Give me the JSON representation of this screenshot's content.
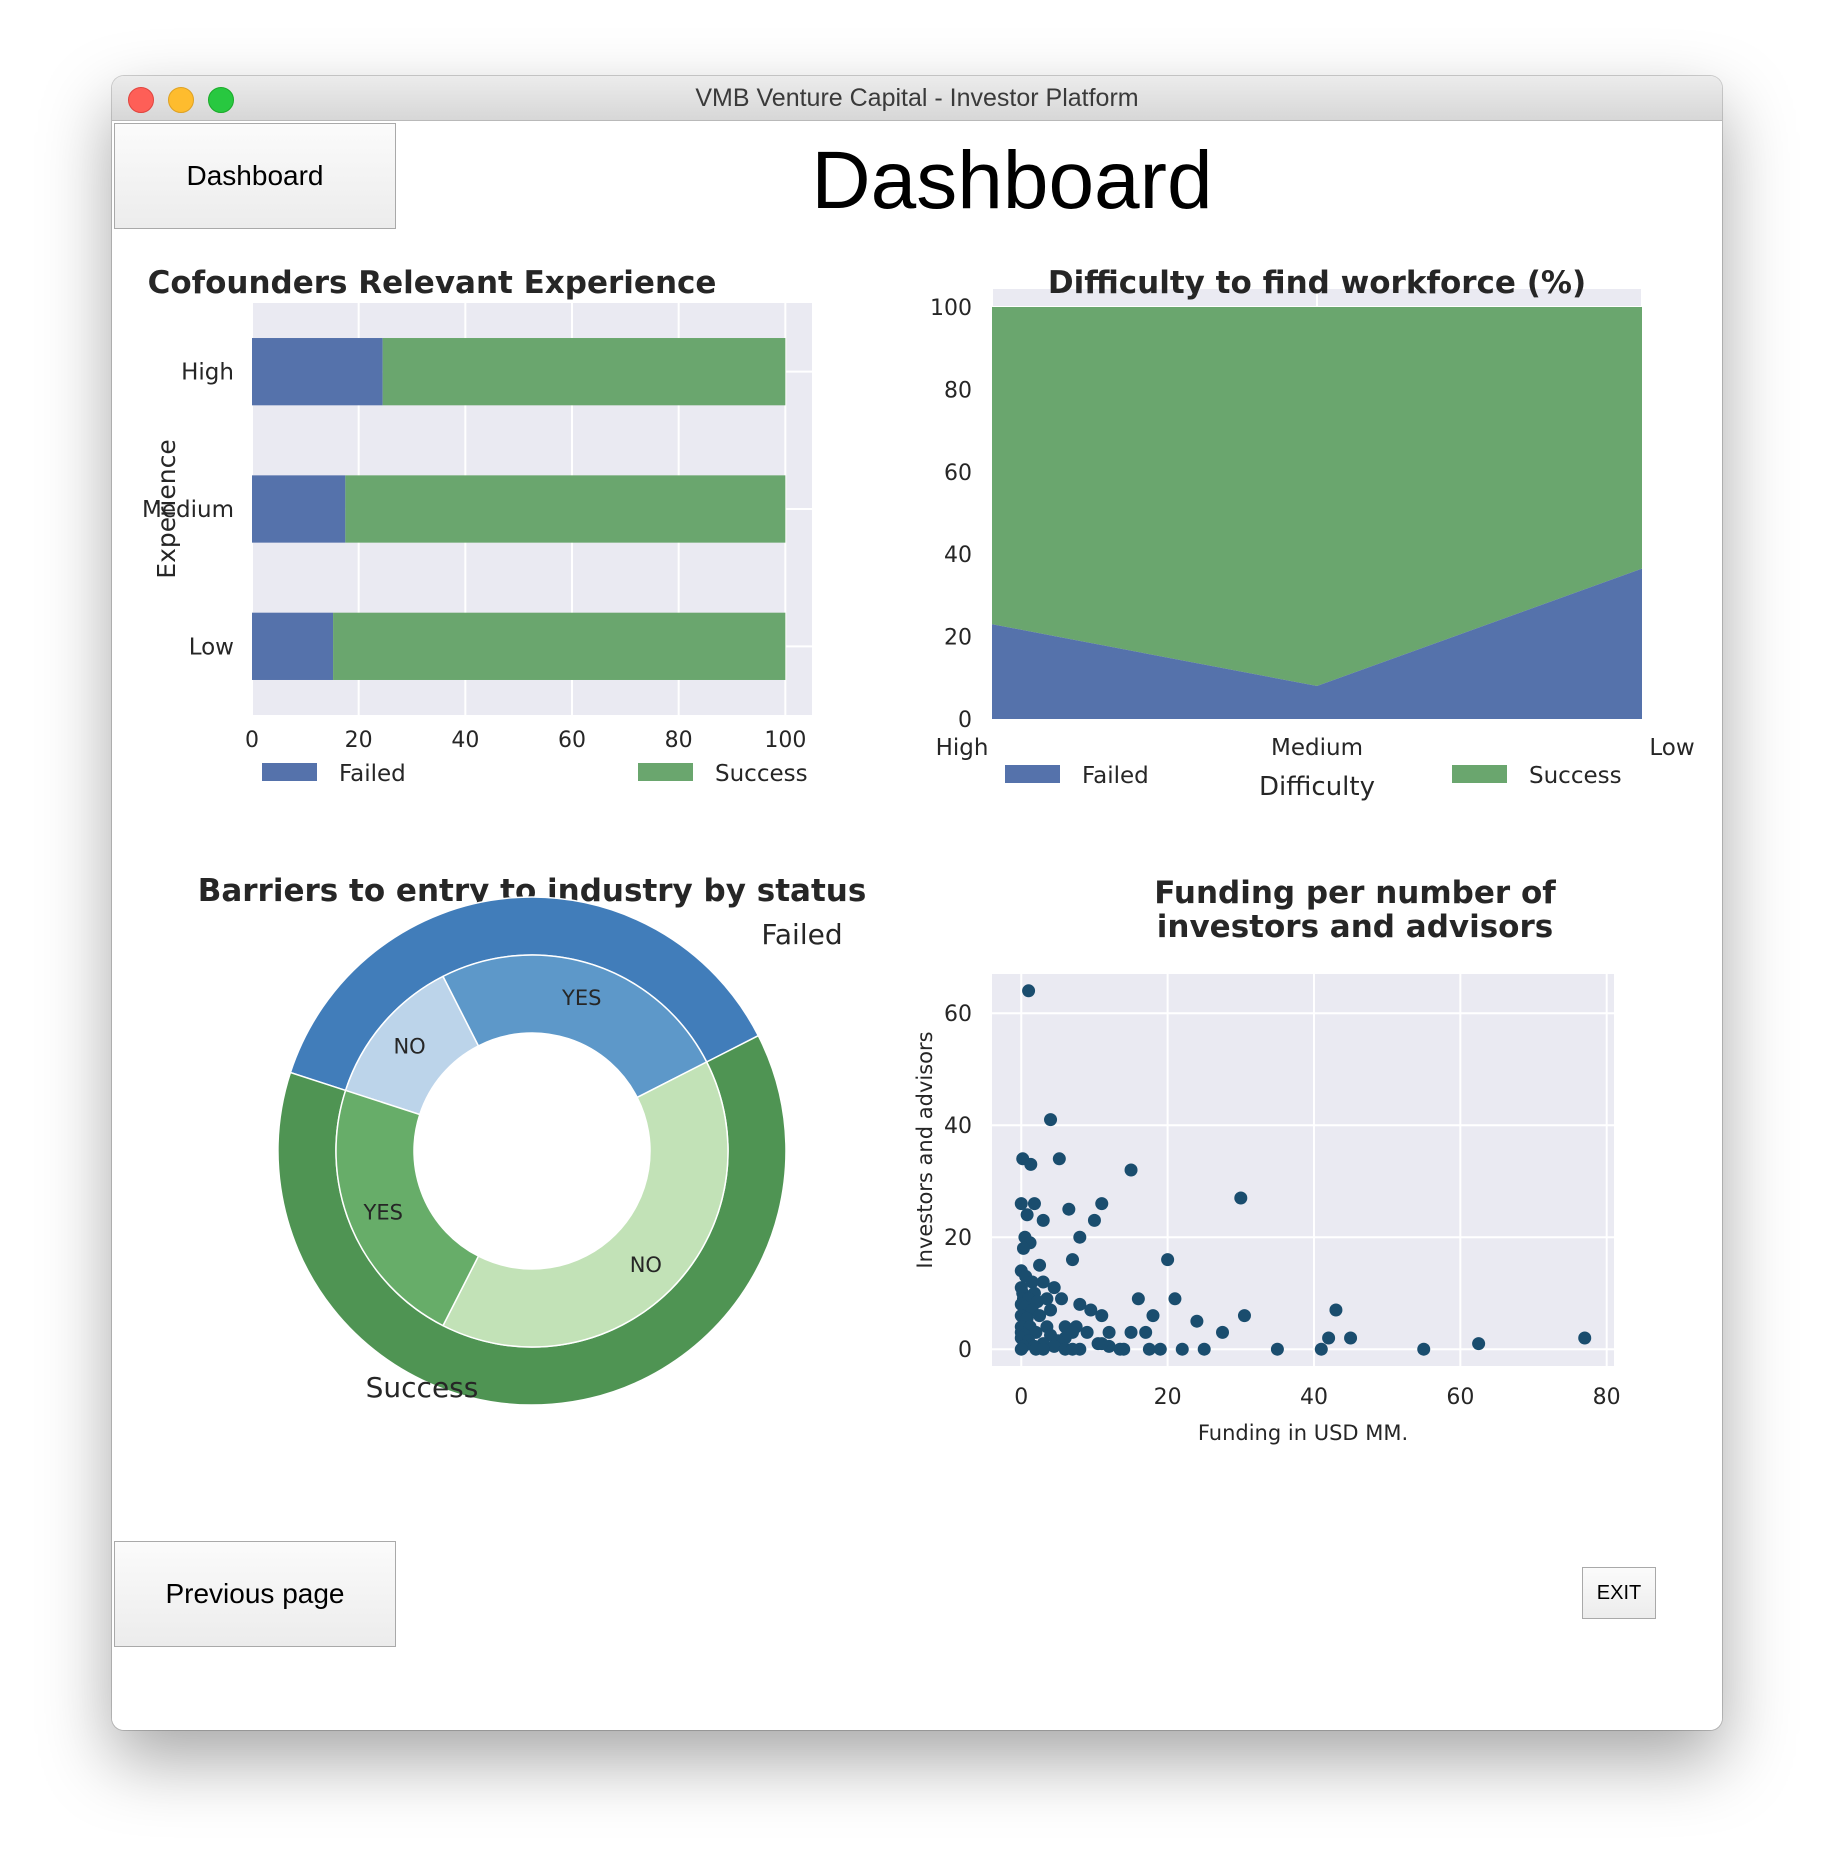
{
  "window": {
    "title": "VMB Venture Capital - Investor Platform"
  },
  "nav": {
    "dashboard_label": "Dashboard",
    "previous_label": "Previous page",
    "exit_label": "EXIT"
  },
  "page": {
    "title": "Dashboard"
  },
  "colors": {
    "failed": "#5572ab",
    "success": "#6aa66e",
    "plot_bg": "#eaeaf2",
    "scatter": "#1a4d6e"
  },
  "chart_data": [
    {
      "type": "bar",
      "orientation": "horizontal",
      "stacked": true,
      "title": "Cofounders Relevant Experience",
      "ylabel": "Experience",
      "xlabel": "",
      "categories": [
        "High",
        "Medium",
        "Low"
      ],
      "series": [
        {
          "name": "Failed",
          "values": [
            24.5,
            17.5,
            15.2
          ]
        },
        {
          "name": "Success",
          "values": [
            75.5,
            82.5,
            84.8
          ]
        }
      ],
      "xlim": [
        0,
        105
      ],
      "xticks": [
        0,
        20,
        40,
        60,
        80,
        100
      ],
      "legend": "bottom",
      "grid": true
    },
    {
      "type": "area",
      "stacked": true,
      "title": "Difficulty to find workforce (%)",
      "xlabel": "Difficulty",
      "ylabel": "",
      "categories": [
        "High",
        "Medium",
        "Low"
      ],
      "series": [
        {
          "name": "Failed",
          "values": [
            23,
            8,
            36.5
          ]
        },
        {
          "name": "Success",
          "values": [
            77,
            92,
            63.5
          ]
        }
      ],
      "ylim": [
        0,
        100
      ],
      "yticks": [
        0,
        20,
        40,
        60,
        80,
        100
      ],
      "legend": "bottom",
      "grid": true
    },
    {
      "type": "pie",
      "style": "nested-donut",
      "title": "Barriers to entry to industry by status",
      "outer": [
        {
          "label": "Failed",
          "value": 37.5,
          "color": "#417dba"
        },
        {
          "label": "Success",
          "value": 62.5,
          "color": "#4f9453"
        }
      ],
      "inner": [
        {
          "label": "NO",
          "value": 12.5,
          "color": "#bcd4ea"
        },
        {
          "label": "YES",
          "value": 25,
          "color": "#5d98c9"
        },
        {
          "label": "NO",
          "value": 40,
          "color": "#c2e2b7"
        },
        {
          "label": "YES",
          "value": 22.5,
          "color": "#67ad69"
        }
      ],
      "start_angle_deg": 63,
      "direction": "clockwise"
    },
    {
      "type": "scatter",
      "title": "Funding per number of investors and advisors",
      "title_lines": [
        "Funding per number of",
        "investors and advisors"
      ],
      "xlabel": "Funding in USD MM.",
      "ylabel": "Investors and advisors",
      "xlim": [
        -4,
        81
      ],
      "ylim": [
        -3,
        67
      ],
      "xticks": [
        0,
        20,
        40,
        60,
        80
      ],
      "yticks": [
        0,
        20,
        40,
        60
      ],
      "grid": true,
      "points": [
        [
          1,
          64
        ],
        [
          4,
          41
        ],
        [
          0.2,
          34
        ],
        [
          1.3,
          33
        ],
        [
          5.2,
          34
        ],
        [
          15,
          32
        ],
        [
          30,
          27
        ],
        [
          0,
          26
        ],
        [
          1.8,
          26
        ],
        [
          0.8,
          24
        ],
        [
          3,
          23
        ],
        [
          6.5,
          25
        ],
        [
          11,
          26
        ],
        [
          10,
          23
        ],
        [
          8,
          20
        ],
        [
          0.5,
          20
        ],
        [
          1.2,
          19
        ],
        [
          0.3,
          18
        ],
        [
          7,
          16
        ],
        [
          20,
          16
        ],
        [
          2.5,
          15
        ],
        [
          0,
          14
        ],
        [
          0.6,
          13
        ],
        [
          1.5,
          12
        ],
        [
          3,
          12
        ],
        [
          4.5,
          11
        ],
        [
          0,
          11
        ],
        [
          0.2,
          10
        ],
        [
          1.8,
          10
        ],
        [
          0.3,
          9
        ],
        [
          1,
          9
        ],
        [
          2.2,
          8.5
        ],
        [
          3.5,
          9
        ],
        [
          5.5,
          9
        ],
        [
          0,
          8
        ],
        [
          0.5,
          7.5
        ],
        [
          1.5,
          7
        ],
        [
          4,
          7
        ],
        [
          8,
          8
        ],
        [
          9.5,
          7
        ],
        [
          11,
          6
        ],
        [
          16,
          9
        ],
        [
          18,
          6
        ],
        [
          21,
          9
        ],
        [
          24,
          5
        ],
        [
          30.5,
          6
        ],
        [
          43,
          7
        ],
        [
          0,
          6
        ],
        [
          0.8,
          5.5
        ],
        [
          2.5,
          6
        ],
        [
          0,
          4
        ],
        [
          1.2,
          4
        ],
        [
          3.5,
          4
        ],
        [
          6,
          4
        ],
        [
          7.5,
          4
        ],
        [
          0,
          3
        ],
        [
          0.5,
          2.5
        ],
        [
          2,
          3
        ],
        [
          4,
          2.5
        ],
        [
          6,
          2
        ],
        [
          7,
          3
        ],
        [
          9,
          3
        ],
        [
          12,
          3
        ],
        [
          15,
          3
        ],
        [
          17,
          3
        ],
        [
          27.5,
          3
        ],
        [
          42,
          2
        ],
        [
          45,
          2
        ],
        [
          62.5,
          1
        ],
        [
          77,
          2
        ],
        [
          0,
          2
        ],
        [
          1,
          1.5
        ],
        [
          3,
          1
        ],
        [
          5,
          1.5
        ],
        [
          0.3,
          0.5
        ],
        [
          1.8,
          0.5
        ],
        [
          4.5,
          0.5
        ],
        [
          0,
          0
        ],
        [
          2,
          0
        ],
        [
          6,
          0
        ],
        [
          8,
          0
        ],
        [
          10.5,
          1
        ],
        [
          12,
          0.5
        ],
        [
          13.5,
          0
        ],
        [
          14,
          0
        ],
        [
          17.5,
          0
        ],
        [
          19,
          0
        ],
        [
          22,
          0
        ],
        [
          25,
          0
        ],
        [
          35,
          0
        ],
        [
          41,
          0
        ],
        [
          55,
          0
        ],
        [
          7,
          0
        ],
        [
          3,
          0
        ],
        [
          11,
          1
        ]
      ]
    }
  ]
}
